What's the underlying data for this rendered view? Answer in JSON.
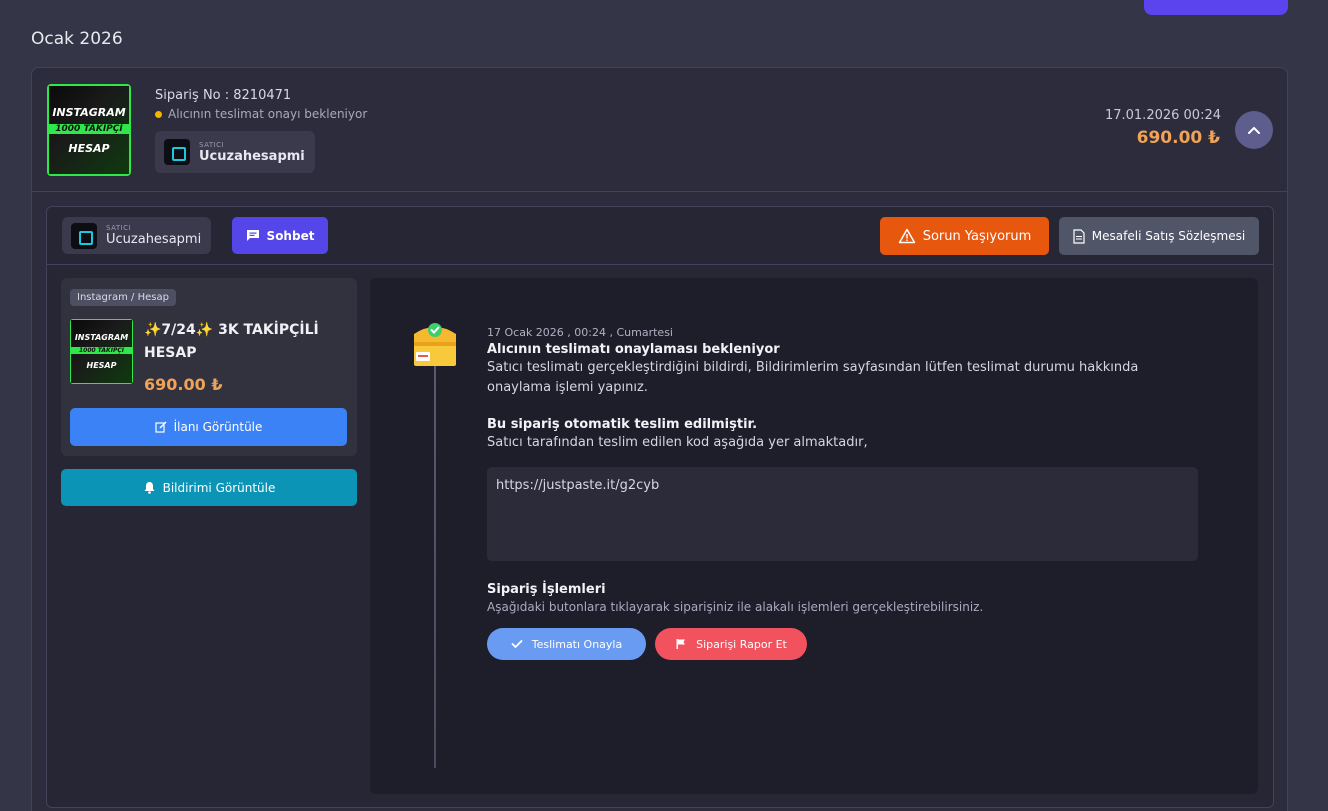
{
  "month_label": "Ocak 2026",
  "order": {
    "number_label": "Sipariş No : 8210471",
    "status": "Alıcının teslimat onayı bekleniyor",
    "seller_small": "SATICI",
    "seller_name": "Ucuzahesapmi",
    "date": "17.01.2026 00:24",
    "price": "690.00 ₺",
    "thumb_lines": [
      "INSTAGRAM",
      "1000 TAKİPÇİ",
      "HESAP"
    ]
  },
  "detail": {
    "seller_small": "SATICI",
    "seller_name": "Ucuzahesapmi",
    "chat_label": "Sohbet",
    "problem_label": "Sorun Yaşıyorum",
    "contract_label": "Mesafeli Satış Sözleşmesi"
  },
  "product": {
    "category": "Instagram / Hesap",
    "title": "✨7/24✨ 3K TAKİPÇİLİ HESAP",
    "price": "690.00 ₺",
    "view_label": "İlanı Görüntüle",
    "notif_label": "Bildirimi Görüntüle"
  },
  "timeline": {
    "date": "17 Ocak 2026 , 00:24 , Cumartesi",
    "title": "Alıcının teslimatı onaylaması bekleniyor",
    "text": "Satıcı teslimatı gerçekleştirdiğini bildirdi, Bildirimlerim sayfasından lütfen teslimat durumu hakkında onaylama işlemi yapınız.",
    "auto_title": "Bu sipariş otomatik teslim edilmiştir.",
    "auto_text": "Satıcı tarafından teslim edilen kod aşağıda yer almaktadır,",
    "code": "https://justpaste.it/g2cyb",
    "ops_title": "Sipariş İşlemleri",
    "ops_sub": "Aşağıdaki butonlara tıklayarak siparişiniz ile alakalı işlemleri gerçekleştirebilirsiniz.",
    "confirm_label": "Teslimatı Onayla",
    "report_label": "Siparişi Rapor Et"
  },
  "colors": {
    "accent": "#5446e8",
    "price": "#f0a257",
    "warning": "#e8570e",
    "status_dot": "#f4b400",
    "confirm": "#6a9bf2",
    "report": "#f2515e",
    "notif": "#0b94b5"
  }
}
